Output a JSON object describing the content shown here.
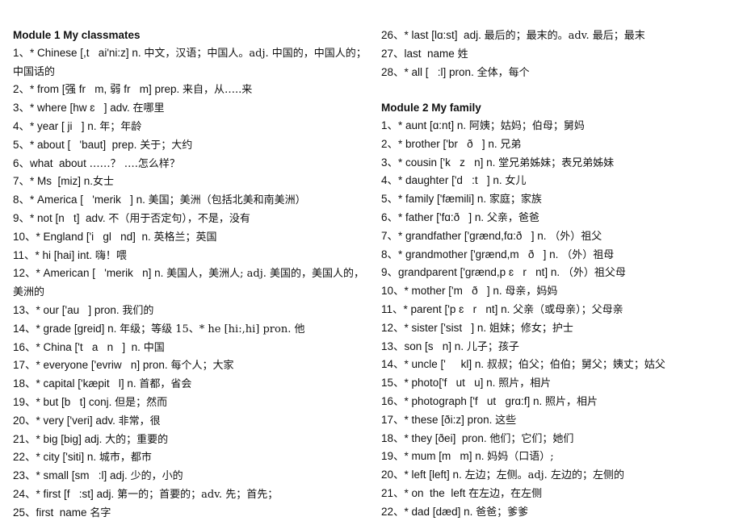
{
  "left_column": {
    "heading": "Module  1  My  classmates",
    "entries": [
      {
        "num": "1、",
        "en": "* Chinese [,t   ai'ni:z] n. ",
        "zh": "中文，汉语；中国人。adj. 中国的，中国人的；中国话的"
      },
      {
        "num": "2、",
        "en": "* from [强 fr   m, 弱 fr   m] prep. ",
        "zh": "来自，从…..来"
      },
      {
        "num": "3、",
        "en": "* where [hw ɛ   ] adv. ",
        "zh": "在哪里"
      },
      {
        "num": "4、",
        "en": "* year [ ji   ] n. ",
        "zh": "年；年龄"
      },
      {
        "num": "5、",
        "en": "* about [   'baut]  prep. ",
        "zh": "关于；大约"
      },
      {
        "num": "6、",
        "en": "what  about ",
        "zh": "……？ ….怎么样？"
      },
      {
        "num": "7、",
        "en": "* Ms  [miz] n.",
        "zh": "女士"
      },
      {
        "num": "8、",
        "en": "* America [   'merik   ] n. ",
        "zh": "美国；美洲（包括北美和南美洲）"
      },
      {
        "num": "9、",
        "en": "* not [n   t]  adv. ",
        "zh": "不（用于否定句），不是，没有"
      },
      {
        "num": "10、",
        "en": "* England ['i   gl   nd]  n. ",
        "zh": "英格兰；英国"
      },
      {
        "num": "11、",
        "en": "* hi [hai] int. ",
        "zh": "嗨！喂"
      },
      {
        "num": "12、",
        "en": "* American [   'merik   n] n. ",
        "zh": "美国人，美洲人;  adj. 美国的，美国人的，美洲的"
      },
      {
        "num": "13、",
        "en": "* our ['au   ] pron. ",
        "zh": "我们的"
      },
      {
        "num": "14、",
        "en": "* grade [greid] n. ",
        "zh": "年级；等级 15、* he [hi:,hi] pron. 他"
      },
      {
        "num": "16、",
        "en": "* China ['t   a   n   ]  n. ",
        "zh": "中国"
      },
      {
        "num": "17、",
        "en": "* everyone ['evriw   n] pron. ",
        "zh": "每个人；大家"
      },
      {
        "num": "18、",
        "en": "* capital ['kæpit   l] n. ",
        "zh": "首都，省会"
      },
      {
        "num": "19、",
        "en": "* but [b   t] conj. ",
        "zh": "但是；然而"
      },
      {
        "num": "20、",
        "en": "* very ['veri] adv. ",
        "zh": "非常，很"
      },
      {
        "num": "21、",
        "en": "* big [big] adj. ",
        "zh": "大的；重要的"
      },
      {
        "num": "22、",
        "en": "* city ['siti] n. ",
        "zh": "城市，都市"
      },
      {
        "num": "23、",
        "en": "* small [sm   :l] adj. ",
        "zh": "少的，小的"
      },
      {
        "num": "24、",
        "en": "* first [f   :st] adj. ",
        "zh": "第一的；首要的；adv. 先；首先；"
      },
      {
        "num": "25、",
        "en": "first  name ",
        "zh": "名字"
      }
    ]
  },
  "right_column": {
    "top_entries": [
      {
        "num": "26、",
        "en": "* last [lɑ:st]  adj. ",
        "zh": "最后的；最末的。adv. 最后；最末"
      },
      {
        "num": "27、",
        "en": "last  name ",
        "zh": "姓"
      },
      {
        "num": "28、",
        "en": "* all [   :l] pron. ",
        "zh": "全体，每个"
      }
    ],
    "heading": "Module  2  My  family",
    "entries": [
      {
        "num": "1、",
        "en": "* aunt [ɑ:nt] n. ",
        "zh": "阿姨；姑妈；伯母；舅妈"
      },
      {
        "num": "2、",
        "en": "* brother ['br   ð   ] n. ",
        "zh": "兄弟"
      },
      {
        "num": "3、",
        "en": "* cousin ['k   z   n] n. ",
        "zh": "堂兄弟姊妹；表兄弟姊妹"
      },
      {
        "num": "4、",
        "en": "* daughter ['d   :t   ] n. ",
        "zh": "女儿"
      },
      {
        "num": "5、",
        "en": "* family ['fæmili] n. ",
        "zh": "家庭；家族"
      },
      {
        "num": "6、",
        "en": "* father ['fɑ:ð   ] n. ",
        "zh": "父亲，爸爸"
      },
      {
        "num": "7、",
        "en": "* grandfather ['grænd,fɑ:ð   ] n. ",
        "zh": "（外）祖父"
      },
      {
        "num": "8、",
        "en": "* grandmother ['grænd,m   ð   ] n. ",
        "zh": "（外）祖母"
      },
      {
        "num": "9、",
        "en": "grandparent ['grænd,p ɛ   r   nt] n. ",
        "zh": "（外）祖父母"
      },
      {
        "num": "10、",
        "en": "* mother ['m   ð   ] n. ",
        "zh": "母亲，妈妈"
      },
      {
        "num": "11、",
        "en": "* parent ['p ɛ   r   nt] n. ",
        "zh": "父亲（或母亲）；父母亲"
      },
      {
        "num": "12、",
        "en": "* sister ['sist   ] n. ",
        "zh": "姐妹；修女；护士"
      },
      {
        "num": "13、",
        "en": "son [s   n] n. ",
        "zh": "儿子；孩子"
      },
      {
        "num": "14、",
        "en": "* uncle ['     kl] n. ",
        "zh": "叔叔；伯父；伯伯；舅父；姨丈；姑父"
      },
      {
        "num": "15、",
        "en": "* photo['f   ut   u] n. ",
        "zh": "照片，相片"
      },
      {
        "num": "16、",
        "en": "* photograph ['f   ut   grɑ:f] n. ",
        "zh": "照片，相片"
      },
      {
        "num": "17、",
        "en": "* these [ði:z] pron. ",
        "zh": "这些"
      },
      {
        "num": "18、",
        "en": "* they [ðei]  pron. ",
        "zh": "他们；它们；她们"
      },
      {
        "num": "19、",
        "en": "* mum [m   m] n. ",
        "zh": "妈妈（口语）;"
      },
      {
        "num": "20、",
        "en": "* left [left] n. ",
        "zh": "左边；左侧。adj. 左边的；左侧的"
      },
      {
        "num": "21、",
        "en": "* on  the  left ",
        "zh": "在左边，在左侧"
      },
      {
        "num": "22、",
        "en": "* dad [dæd] n. ",
        "zh": "爸爸；爹爹"
      }
    ]
  }
}
